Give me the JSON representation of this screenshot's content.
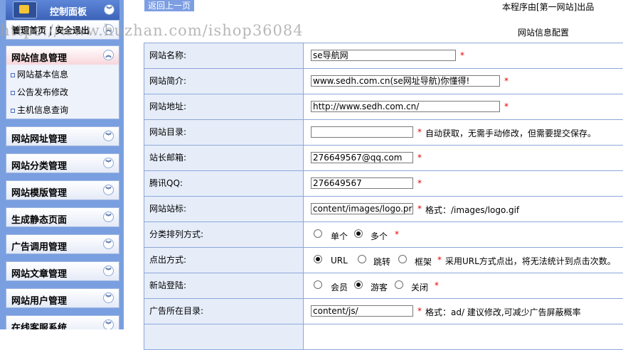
{
  "sidebar": {
    "panel_title": "控制面板",
    "links": "管理首页 | 安全退出",
    "open_group": {
      "title": "网站信息管理",
      "items": [
        "网站基本信息",
        "公告发布修改",
        "主机信息查询"
      ]
    },
    "groups": [
      "网站网址管理",
      "网站分类管理",
      "网站模版管理",
      "生成静态页面",
      "广告调用管理",
      "网站文章管理",
      "网站用户管理",
      "在线客服系统"
    ]
  },
  "topbar": {
    "back_label": "返回上一页",
    "credit": "本程序由[第一网站]出品",
    "watermark": "https://www.huzhan.com/ishop36084"
  },
  "form": {
    "title": "网站信息配置",
    "site_name_label": "网站名称:",
    "site_name_value": "se导航网",
    "site_intro_label": "网站简介:",
    "site_intro_value": "www.sedh.com.cn(se网址导航)你懂得!",
    "site_url_label": "网站地址:",
    "site_url_value": "http://www.sedh.com.cn/",
    "site_dir_label": "网站目录:",
    "site_dir_value": "",
    "site_dir_note": "自动获取，无需手动修改，但需要提交保存。",
    "email_label": "站长邮箱:",
    "email_value": "276649567@qq.com",
    "qq_label": "腾讯QQ:",
    "qq_value": "276649567",
    "logo_label": "网站站标:",
    "logo_value": "content/images/logo.pr",
    "logo_note": "格式：/images/logo.gif",
    "sort_label": "分类排列方式:",
    "sort_options": [
      "单个",
      "多个"
    ],
    "sort_selected": "多个",
    "click_label": "点出方式:",
    "click_options": [
      "URL",
      "跳转",
      "框架"
    ],
    "click_selected": "URL",
    "click_note": "采用URL方式点出，将无法统计到点击次数。",
    "register_label": "新站登陆:",
    "register_options": [
      "会员",
      "游客",
      "关闭"
    ],
    "register_selected": "游客",
    "ad_dir_label": "广告所在目录:",
    "ad_dir_value": "content/js/",
    "ad_dir_note": "格式：ad/ 建议修改,可减少广告屏蔽概率",
    "required_mark": "*"
  },
  "colors": {
    "sidebar_bg": "#7a9fe0",
    "label_bg": "#e6edf9",
    "border": "#8da7d8",
    "required": "#e00000"
  }
}
